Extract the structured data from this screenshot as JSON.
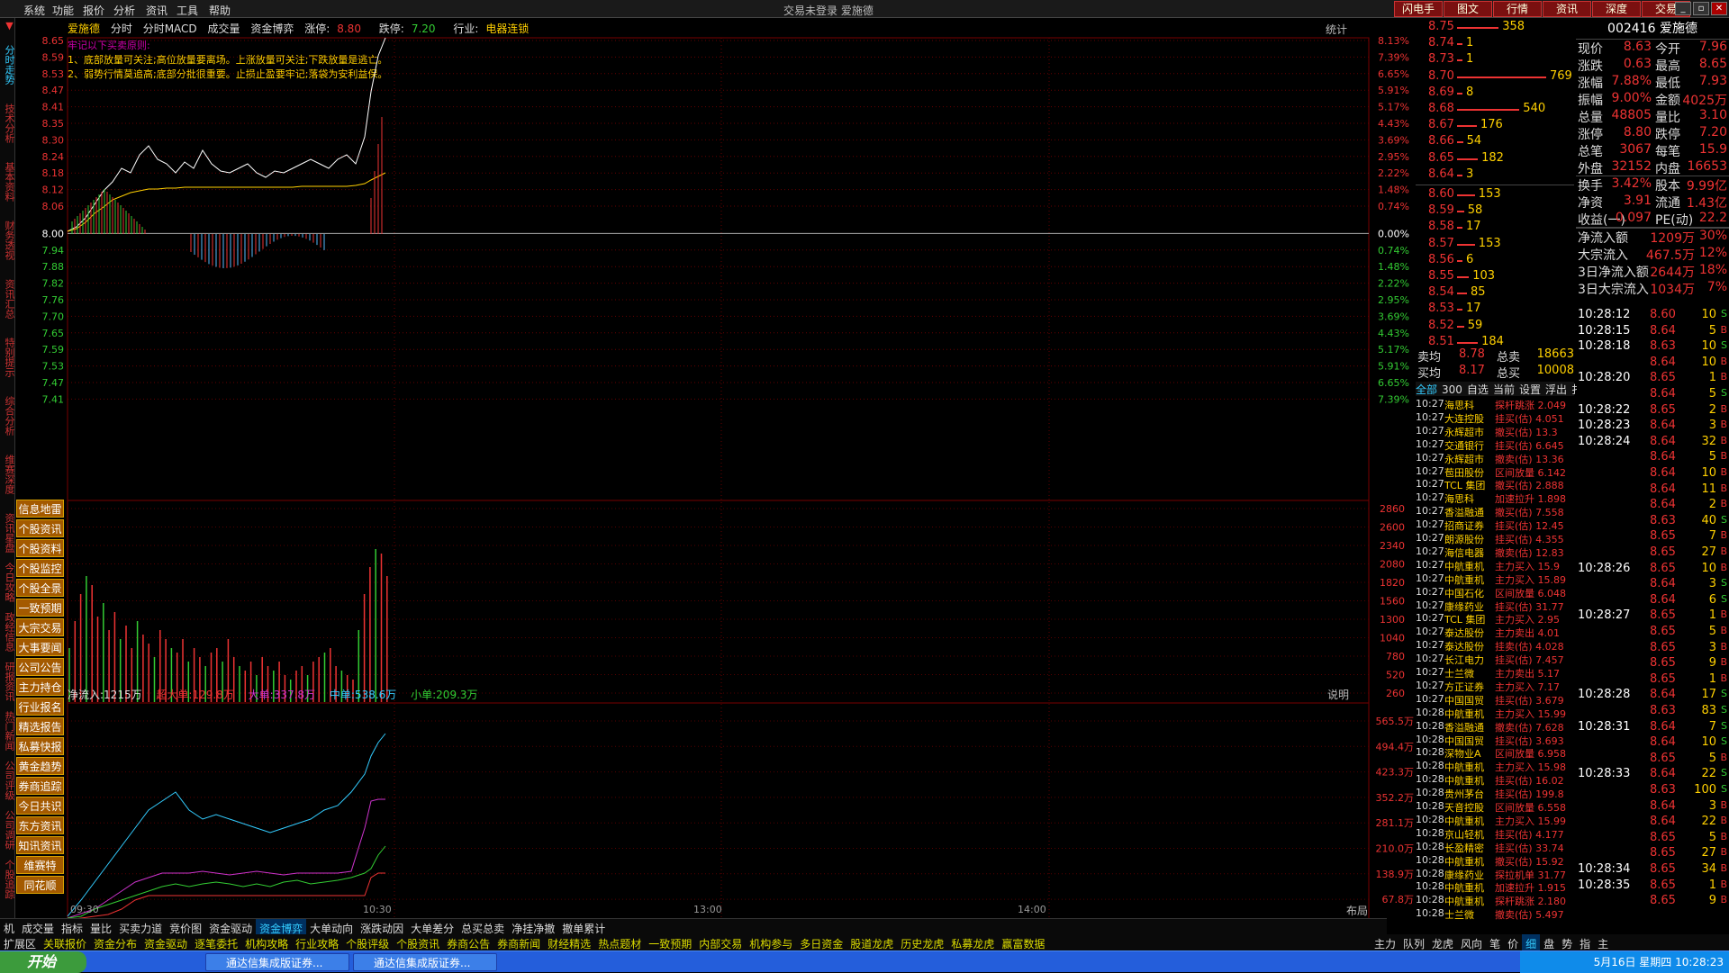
{
  "menu": [
    "系统",
    "功能",
    "报价",
    "分析",
    "资讯",
    "工具",
    "帮助"
  ],
  "app_title": "交易未登录    爱施德",
  "top_right_buttons": [
    "闪电手",
    "图文",
    "行情",
    "资讯",
    "深度",
    "交易"
  ],
  "left_nav_tabs": [
    "分时走势",
    "技术分析",
    "基本资料",
    "财务透视",
    "资讯汇总",
    "特别提示",
    "综合分析",
    "维赛深度",
    "资讯星盘",
    "今日攻略",
    "政经信息",
    "研报资讯",
    "热门新闻",
    "公司评级",
    "公司调研",
    "个股追踪"
  ],
  "info_buttons": [
    "信息地雷",
    "个股资讯",
    "个股资料",
    "个股监控",
    "个股全景",
    "一致预期",
    "大宗交易",
    "大事要闻",
    "公司公告",
    "主力持仓",
    "行业报名",
    "精选报告",
    "私募快报",
    "黄金趋势",
    "券商追踪",
    "今日共识",
    "东方资讯",
    "知讯资讯",
    "维赛特",
    "同花顺"
  ],
  "header": {
    "name": "爱施德",
    "items": [
      "分时",
      "分时MACD",
      "成交量",
      "资金博弈"
    ],
    "up_label": "涨停:",
    "up_val": "8.80",
    "down_label": "跌停:",
    "down_val": "7.20",
    "industry_label": "行业:",
    "industry": "电器连锁"
  },
  "rules": {
    "title": "牢记以下买卖原则:",
    "lines": [
      "1、底部放量可关注;高位放量要离场。上涨放量可关注;下跌放量是逃亡。",
      "2、弱势行情莫追高;底部分批很重要。止损止盈要牢记;落袋为安利益保。"
    ]
  },
  "stats_label": "统计",
  "price_axis_left": [
    "8.65",
    "8.59",
    "8.53",
    "8.47",
    "8.41",
    "8.35",
    "8.30",
    "8.24",
    "8.18",
    "8.12",
    "8.06",
    "8.00",
    "7.94",
    "7.88",
    "7.82",
    "7.76",
    "7.70",
    "7.65",
    "7.59",
    "7.53",
    "7.47",
    "7.41"
  ],
  "price_axis_right": [
    "8.13%",
    "7.39%",
    "6.65%",
    "5.91%",
    "5.17%",
    "4.43%",
    "3.69%",
    "2.95%",
    "2.22%",
    "1.48%",
    "0.74%",
    "0.00%",
    "0.74%",
    "1.48%",
    "2.22%",
    "2.95%",
    "3.69%",
    "4.43%",
    "5.17%",
    "5.91%",
    "6.65%",
    "7.39%"
  ],
  "volume_axis": [
    "2860",
    "2600",
    "2340",
    "2080",
    "1820",
    "1560",
    "1300",
    "1040",
    "780",
    "520",
    "260"
  ],
  "indicator": {
    "net": "净流入:1215万",
    "super": "超大单:129.8万",
    "large": "大单:337.8万",
    "medium": "中单:538.6万",
    "small": "小单:209.3万",
    "explain": "说明"
  },
  "indicator_axis": [
    "565.5万",
    "494.4万",
    "423.3万",
    "352.2万",
    "281.1万",
    "210.0万",
    "138.9万",
    "67.8万"
  ],
  "x_axis": [
    "09:30",
    "10:30",
    "13:00",
    "14:00"
  ],
  "layout_btn": "布局",
  "bottom_tabs_1": [
    "机",
    "成交量",
    "指标",
    "量比",
    "买卖力道",
    "竞价图",
    "资金驱动",
    "资金博弈",
    "大单动向",
    "涨跌动因",
    "大单差分",
    "总买总卖",
    "净挂净撤",
    "撤单累计"
  ],
  "bottom_tabs_1_active": 7,
  "bottom_tabs_2": [
    "扩展区",
    "关联报价",
    "资金分布",
    "资金驱动",
    "逐笔委托",
    "机构攻略",
    "行业攻略",
    "个股评级",
    "个股资讯",
    "券商公告",
    "券商新闻",
    "财经精选",
    "热点题材",
    "一致预期",
    "内部交易",
    "机构参与",
    "多日资金",
    "股道龙虎",
    "历史龙虎",
    "私募龙虎",
    "赢富数据"
  ],
  "order_book": {
    "sells": [
      {
        "p": "8.75",
        "v": "358",
        "bar": 0.42
      },
      {
        "p": "8.74",
        "v": "1",
        "bar": 0.0
      },
      {
        "p": "8.73",
        "v": "1",
        "bar": 0.0
      },
      {
        "p": "8.70",
        "v": "769",
        "bar": 0.9
      },
      {
        "p": "8.69",
        "v": "8",
        "bar": 0.01
      },
      {
        "p": "8.68",
        "v": "540",
        "bar": 0.63
      },
      {
        "p": "8.67",
        "v": "176",
        "bar": 0.2
      },
      {
        "p": "8.66",
        "v": "54",
        "bar": 0.06
      },
      {
        "p": "8.65",
        "v": "182",
        "bar": 0.21
      },
      {
        "p": "8.64",
        "v": "3",
        "bar": 0.0
      }
    ],
    "buys": [
      {
        "p": "8.60",
        "v": "153",
        "bar": 0.18
      },
      {
        "p": "8.59",
        "v": "58",
        "bar": 0.07
      },
      {
        "p": "8.58",
        "v": "17",
        "bar": 0.02
      },
      {
        "p": "8.57",
        "v": "153",
        "bar": 0.18
      },
      {
        "p": "8.56",
        "v": "6",
        "bar": 0.0
      },
      {
        "p": "8.55",
        "v": "103",
        "bar": 0.12
      },
      {
        "p": "8.54",
        "v": "85",
        "bar": 0.1
      },
      {
        "p": "8.53",
        "v": "17",
        "bar": 0.02
      },
      {
        "p": "8.52",
        "v": "59",
        "bar": 0.07
      },
      {
        "p": "8.51",
        "v": "184",
        "bar": 0.21
      }
    ],
    "ask_avg_label": "卖均",
    "ask_avg": "8.78",
    "ask_total_label": "总卖",
    "ask_total": "18663",
    "bid_avg_label": "买均",
    "bid_avg": "8.17",
    "bid_total_label": "总买",
    "bid_total": "10008"
  },
  "filter_tabs": [
    "全部",
    "300",
    "自选",
    "当前",
    "设置",
    "浮出",
    "扌"
  ],
  "trades": [
    {
      "t": "10:27",
      "s": "海思科",
      "a": "探杆跳涨 2.049"
    },
    {
      "t": "10:27",
      "s": "大连控股",
      "a": "挂买(估) 4.051"
    },
    {
      "t": "10:27",
      "s": "永辉超市",
      "a": "撤买(估) 13.3"
    },
    {
      "t": "10:27",
      "s": "交通银行",
      "a": "挂买(估) 6.645"
    },
    {
      "t": "10:27",
      "s": "永辉超市",
      "a": "撤卖(估) 13.36"
    },
    {
      "t": "10:27",
      "s": "苞田股份",
      "a": "区间放量 6.142"
    },
    {
      "t": "10:27",
      "s": "TCL 集团",
      "a": "撤买(估) 2.888"
    },
    {
      "t": "10:27",
      "s": "海思科",
      "a": "加速拉升 1.898"
    },
    {
      "t": "10:27",
      "s": "香溢融通",
      "a": "撤买(估) 7.558"
    },
    {
      "t": "10:27",
      "s": "招商证券",
      "a": "挂买(估) 12.45"
    },
    {
      "t": "10:27",
      "s": "朗源股份",
      "a": "挂买(估) 4.355"
    },
    {
      "t": "10:27",
      "s": "海信电器",
      "a": "撤卖(估) 12.83"
    },
    {
      "t": "10:27",
      "s": "中航重机",
      "a": "主力买入 15.9"
    },
    {
      "t": "10:27",
      "s": "中航重机",
      "a": "主力买入 15.89"
    },
    {
      "t": "10:27",
      "s": "中国石化",
      "a": "区间放量 6.048"
    },
    {
      "t": "10:27",
      "s": "康缘药业",
      "a": "挂买(估) 31.77"
    },
    {
      "t": "10:27",
      "s": "TCL 集团",
      "a": "主力买入 2.95"
    },
    {
      "t": "10:27",
      "s": "泰达股份",
      "a": "主力卖出 4.01"
    },
    {
      "t": "10:27",
      "s": "泰达股份",
      "a": "挂卖(估) 4.028"
    },
    {
      "t": "10:27",
      "s": "长江电力",
      "a": "挂买(估) 7.457"
    },
    {
      "t": "10:27",
      "s": "士兰微",
      "a": "主力卖出 5.17"
    },
    {
      "t": "10:27",
      "s": "方正证券",
      "a": "主力买入 7.17"
    },
    {
      "t": "10:27",
      "s": "中国国贸",
      "a": "挂买(估) 3.679"
    },
    {
      "t": "10:28",
      "s": "中航重机",
      "a": "主力买入 15.99"
    },
    {
      "t": "10:28",
      "s": "香溢融通",
      "a": "撤卖(估) 7.628"
    },
    {
      "t": "10:28",
      "s": "中国国贸",
      "a": "挂买(估) 3.693"
    },
    {
      "t": "10:28",
      "s": "深物业A",
      "a": "区间放量 6.958"
    },
    {
      "t": "10:28",
      "s": "中航重机",
      "a": "主力买入 15.98"
    },
    {
      "t": "10:28",
      "s": "中航重机",
      "a": "挂买(估) 16.02"
    },
    {
      "t": "10:28",
      "s": "贵州茅台",
      "a": "挂买(估) 199.8"
    },
    {
      "t": "10:28",
      "s": "天音控股",
      "a": "区间放量 6.558"
    },
    {
      "t": "10:28",
      "s": "中航重机",
      "a": "主力买入 15.99"
    },
    {
      "t": "10:28",
      "s": "京山轻机",
      "a": "挂买(估) 4.177"
    },
    {
      "t": "10:28",
      "s": "长盈精密",
      "a": "挂买(估) 33.74"
    },
    {
      "t": "10:28",
      "s": "中航重机",
      "a": "撤买(估) 15.92"
    },
    {
      "t": "10:28",
      "s": "康缘药业",
      "a": "探拉机单 31.77"
    },
    {
      "t": "10:28",
      "s": "中航重机",
      "a": "加速拉升 1.915"
    },
    {
      "t": "10:28",
      "s": "中航重机",
      "a": "探杆跳涨 2.180"
    },
    {
      "t": "10:28",
      "s": "士兰微",
      "a": "撤卖(估) 5.497"
    }
  ],
  "quote": {
    "title": "002416 爱施德",
    "rows": [
      {
        "k": "现价",
        "v": "8.63",
        "k2": "今开",
        "v2": "7.96"
      },
      {
        "k": "涨跌",
        "v": "0.63",
        "k2": "最高",
        "v2": "8.65"
      },
      {
        "k": "涨幅",
        "v": "7.88%",
        "k2": "最低",
        "v2": "7.93"
      },
      {
        "k": "振幅",
        "v": "9.00%",
        "k2": "金额",
        "v2": "4025万"
      },
      {
        "k": "总量",
        "v": "48805",
        "k2": "量比",
        "v2": "3.10"
      },
      {
        "k": "涨停",
        "v": "8.80",
        "k2": "跌停",
        "v2": "7.20"
      },
      {
        "k": "总笔",
        "v": "3067",
        "k2": "每笔",
        "v2": "15.9"
      },
      {
        "k": "外盘",
        "v": "32152",
        "k2": "内盘",
        "v2": "16653"
      },
      {
        "k": "换手",
        "v": "3.42%",
        "k2": "股本",
        "v2": "9.99亿"
      },
      {
        "k": "净资",
        "v": "3.91",
        "k2": "流通",
        "v2": "1.43亿"
      },
      {
        "k": "收益(一)",
        "v": "0.097",
        "k2": "PE(动)",
        "v2": "22.2"
      }
    ],
    "flows": [
      {
        "k": "净流入额",
        "v": "1209万",
        "p": "30%"
      },
      {
        "k": "大宗流入",
        "v": "467.5万",
        "p": "12%"
      },
      {
        "k": "3日净流入额",
        "v": "2644万",
        "p": "18%"
      },
      {
        "k": "3日大宗流入",
        "v": "1034万",
        "p": "7%"
      }
    ]
  },
  "ticks": [
    {
      "t": "10:28:12",
      "p": "8.60",
      "v": "10",
      "d": "S"
    },
    {
      "t": "10:28:15",
      "p": "8.64",
      "v": "5",
      "d": "B"
    },
    {
      "t": "10:28:18",
      "p": "8.63",
      "v": "10",
      "d": "S"
    },
    {
      "t": "",
      "p": "8.64",
      "v": "10",
      "d": "B"
    },
    {
      "t": "10:28:20",
      "p": "8.65",
      "v": "1",
      "d": "B"
    },
    {
      "t": "",
      "p": "8.64",
      "v": "5",
      "d": "S"
    },
    {
      "t": "10:28:22",
      "p": "8.65",
      "v": "2",
      "d": "B"
    },
    {
      "t": "10:28:23",
      "p": "8.64",
      "v": "3",
      "d": "B"
    },
    {
      "t": "10:28:24",
      "p": "8.64",
      "v": "32",
      "d": "B"
    },
    {
      "t": "",
      "p": "8.64",
      "v": "5",
      "d": "B"
    },
    {
      "t": "",
      "p": "8.64",
      "v": "10",
      "d": "B"
    },
    {
      "t": "",
      "p": "8.64",
      "v": "11",
      "d": "B"
    },
    {
      "t": "",
      "p": "8.64",
      "v": "2",
      "d": "B"
    },
    {
      "t": "",
      "p": "8.63",
      "v": "40",
      "d": "S"
    },
    {
      "t": "",
      "p": "8.65",
      "v": "7",
      "d": "B"
    },
    {
      "t": "",
      "p": "8.65",
      "v": "27",
      "d": "B"
    },
    {
      "t": "10:28:26",
      "p": "8.65",
      "v": "10",
      "d": "B"
    },
    {
      "t": "",
      "p": "8.64",
      "v": "3",
      "d": "S"
    },
    {
      "t": "",
      "p": "8.64",
      "v": "6",
      "d": "S"
    },
    {
      "t": "10:28:27",
      "p": "8.65",
      "v": "1",
      "d": "B"
    },
    {
      "t": "",
      "p": "8.65",
      "v": "5",
      "d": "B"
    },
    {
      "t": "",
      "p": "8.65",
      "v": "3",
      "d": "B"
    },
    {
      "t": "",
      "p": "8.65",
      "v": "9",
      "d": "B"
    },
    {
      "t": "",
      "p": "8.65",
      "v": "1",
      "d": "B"
    },
    {
      "t": "10:28:28",
      "p": "8.64",
      "v": "17",
      "d": "S"
    },
    {
      "t": "",
      "p": "8.63",
      "v": "83",
      "d": "S"
    },
    {
      "t": "10:28:31",
      "p": "8.64",
      "v": "7",
      "d": "S"
    },
    {
      "t": "",
      "p": "8.64",
      "v": "10",
      "d": "S"
    },
    {
      "t": "",
      "p": "8.65",
      "v": "5",
      "d": "B"
    },
    {
      "t": "10:28:33",
      "p": "8.64",
      "v": "22",
      "d": "S"
    },
    {
      "t": "",
      "p": "8.63",
      "v": "100",
      "d": "S"
    },
    {
      "t": "",
      "p": "8.64",
      "v": "3",
      "d": "B"
    },
    {
      "t": "",
      "p": "8.64",
      "v": "22",
      "d": "B"
    },
    {
      "t": "",
      "p": "8.65",
      "v": "5",
      "d": "B"
    },
    {
      "t": "",
      "p": "8.65",
      "v": "27",
      "d": "B"
    },
    {
      "t": "10:28:34",
      "p": "8.65",
      "v": "34",
      "d": "B"
    },
    {
      "t": "10:28:35",
      "p": "8.65",
      "v": "1",
      "d": "B"
    },
    {
      "t": "",
      "p": "8.65",
      "v": "9",
      "d": "B"
    }
  ],
  "right_tabs": [
    "主力",
    "队列",
    "龙虎",
    "风向",
    "笔",
    "价",
    "细",
    "盘",
    "势",
    "指",
    "主"
  ],
  "right_tabs_active": 6,
  "taskbar": {
    "start": "开始",
    "items": [
      "通达信集成版证券...",
      "通达信集成版证券..."
    ],
    "tray": "5月16日 星期四 10:28:23"
  }
}
